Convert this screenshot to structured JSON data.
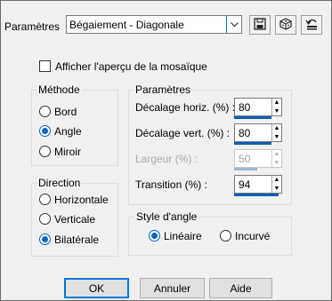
{
  "preset": {
    "label": "Paramètres",
    "value": "Bégaiement - Diagonale"
  },
  "toolbar": {
    "icons": [
      "save-icon",
      "randomize-icon",
      "reset-icon"
    ]
  },
  "preview_checkbox": {
    "label": "Afficher l'aperçu de la mosaïque",
    "checked": false
  },
  "method": {
    "title": "Méthode",
    "options": [
      {
        "label": "Bord",
        "selected": false
      },
      {
        "label": "Angle",
        "selected": true
      },
      {
        "label": "Miroir",
        "selected": false
      }
    ]
  },
  "direction": {
    "title": "Direction",
    "options": [
      {
        "label": "Horizontale",
        "selected": false
      },
      {
        "label": "Verticale",
        "selected": false
      },
      {
        "label": "Bilatérale",
        "selected": true
      }
    ]
  },
  "params": {
    "title": "Paramètres",
    "fields": [
      {
        "label": "Décalage horiz. (%) :",
        "value": "80",
        "enabled": true
      },
      {
        "label": "Décalage vert. (%) :",
        "value": "80",
        "enabled": true
      },
      {
        "label": "Largeur (%) :",
        "value": "50",
        "enabled": false
      },
      {
        "label": "Transition (%) :",
        "value": "94",
        "enabled": true
      }
    ]
  },
  "corner_style": {
    "title": "Style d'angle",
    "options": [
      {
        "label": "Linéaire",
        "selected": true
      },
      {
        "label": "Incurvé",
        "selected": false
      }
    ]
  },
  "buttons": {
    "ok": "OK",
    "cancel": "Annuler",
    "help": "Aide"
  },
  "colors": {
    "accent": "#0067c0",
    "dialog_bg": "#f0f0f0"
  }
}
